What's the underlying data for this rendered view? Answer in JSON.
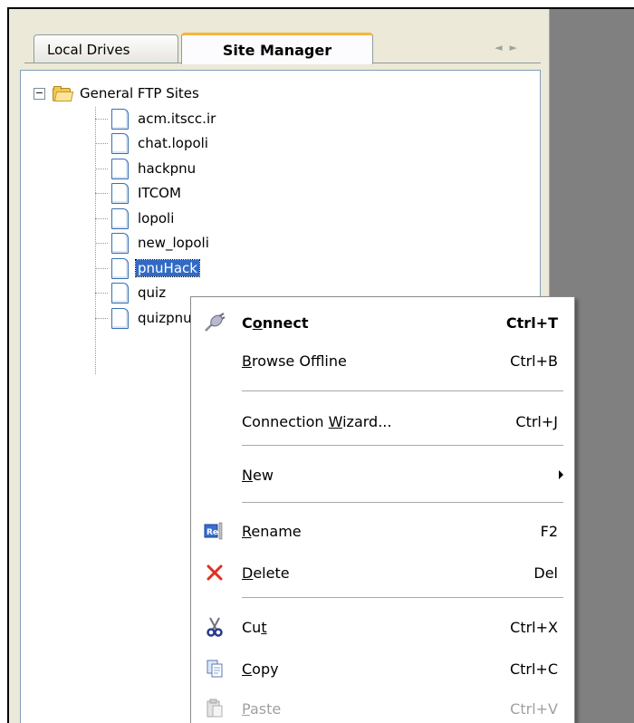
{
  "tabs": {
    "local_drives": "Local Drives",
    "site_manager": "Site Manager"
  },
  "tree": {
    "root_label": "General FTP Sites",
    "items": [
      {
        "label": "acm.itscc.ir"
      },
      {
        "label": "chat.lopoli"
      },
      {
        "label": "hackpnu"
      },
      {
        "label": "ITCOM"
      },
      {
        "label": "lopoli"
      },
      {
        "label": "new_lopoli"
      },
      {
        "label": "pnuHack",
        "selected": true
      },
      {
        "label": "quiz"
      },
      {
        "label": "quizpnu"
      }
    ]
  },
  "context_menu": {
    "connect": {
      "label": "Connect",
      "shortcut": "Ctrl+T",
      "icon": "plug-icon"
    },
    "browse_offline": {
      "label": "Browse Offline",
      "shortcut": "Ctrl+B"
    },
    "connection_wizard": {
      "label": "Connection Wizard...",
      "shortcut": "Ctrl+J"
    },
    "new": {
      "label": "New",
      "icon": "submenu-arrow-icon"
    },
    "rename": {
      "label": "Rename",
      "shortcut": "F2",
      "icon": "rename-icon"
    },
    "delete": {
      "label": "Delete",
      "shortcut": "Del",
      "icon": "delete-x-icon"
    },
    "cut": {
      "label": "Cut",
      "shortcut": "Ctrl+X",
      "icon": "scissors-icon"
    },
    "copy": {
      "label": "Copy",
      "shortcut": "Ctrl+C",
      "icon": "copy-icon"
    },
    "paste": {
      "label": "Paste",
      "shortcut": "Ctrl+V",
      "icon": "paste-icon",
      "disabled": true
    }
  },
  "colors": {
    "selection": "#316ac5",
    "active_tab_accent": "#f5b53f",
    "delete_red": "#e03020"
  }
}
